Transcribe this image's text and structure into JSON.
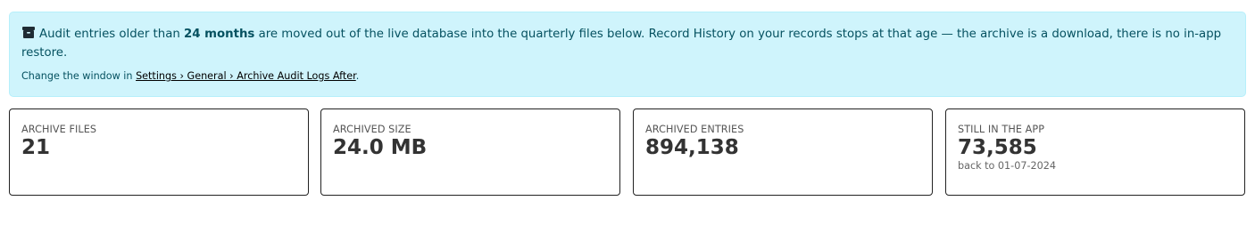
{
  "notice": {
    "text_before": "Audit entries older than ",
    "highlight": "24 months",
    "text_after": " are moved out of the live database into the quarterly files below. Record History on your records stops at that age — the archive is a download, there is no in-app restore.",
    "change_prefix": "Change the window in ",
    "settings_path": "Settings › General › Archive Audit Logs After",
    "change_suffix": ".",
    "icon": "archive-box-icon"
  },
  "stats": [
    {
      "label": "ARCHIVE FILES",
      "value": "21",
      "sub": ""
    },
    {
      "label": "ARCHIVED SIZE",
      "value": "24.0 MB",
      "sub": ""
    },
    {
      "label": "ARCHIVED ENTRIES",
      "value": "894,138",
      "sub": ""
    },
    {
      "label": "STILL IN THE APP",
      "value": "73,585",
      "sub": "back to 01-07-2024"
    }
  ]
}
